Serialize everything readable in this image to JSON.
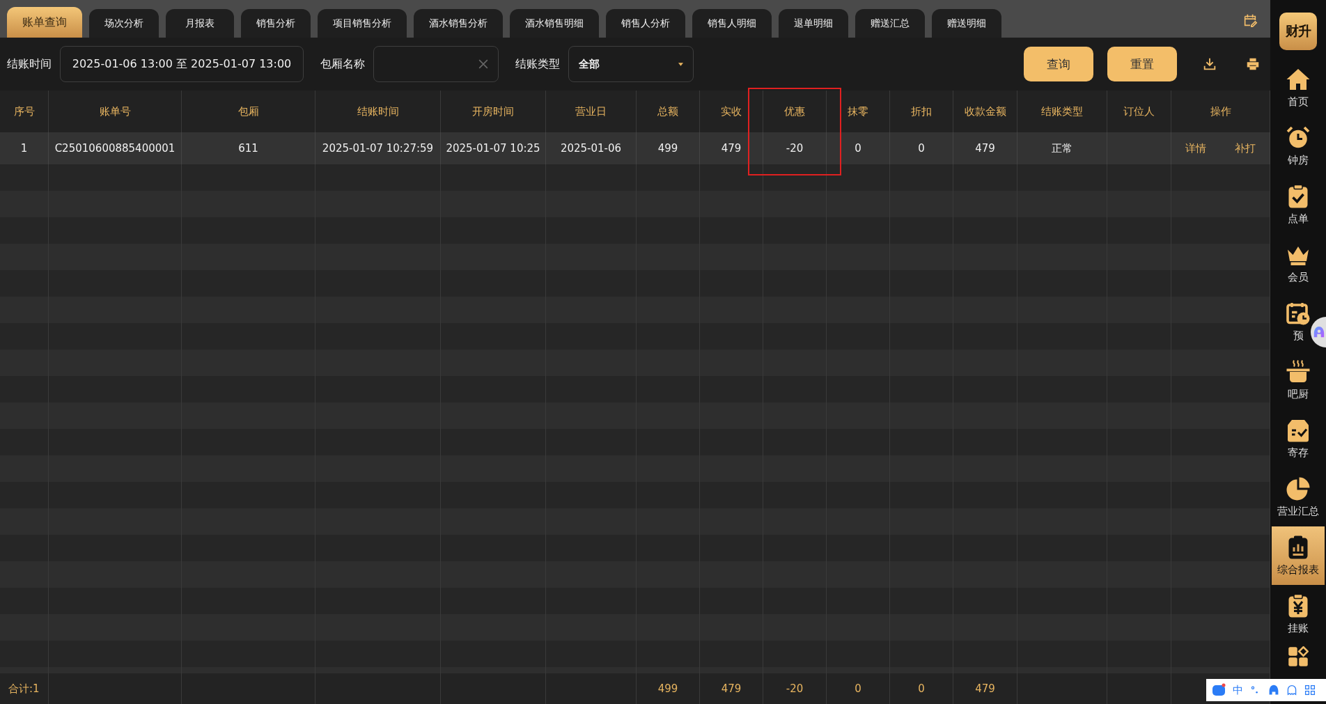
{
  "tabs": [
    {
      "label": "账单查询",
      "selected": true
    },
    {
      "label": "场次分析",
      "selected": false
    },
    {
      "label": "月报表",
      "selected": false
    },
    {
      "label": "销售分析",
      "selected": false
    },
    {
      "label": "项目销售分析",
      "selected": false
    },
    {
      "label": "酒水销售分析",
      "selected": false
    },
    {
      "label": "酒水销售明细",
      "selected": false
    },
    {
      "label": "销售人分析",
      "selected": false
    },
    {
      "label": "销售人明细",
      "selected": false
    },
    {
      "label": "退单明细",
      "selected": false
    },
    {
      "label": "赠送汇总",
      "selected": false
    },
    {
      "label": "赠送明细",
      "selected": false
    }
  ],
  "filters": {
    "settle_time": {
      "label": "结账时间",
      "value": "2025-01-06 13:00 至 2025-01-07 13:00"
    },
    "room_name": {
      "label": "包厢名称"
    },
    "settle_type": {
      "label": "结账类型",
      "value": "全部"
    }
  },
  "buttons": [
    "查询",
    "重置"
  ],
  "table": {
    "columns": [
      {
        "title": "序号",
        "highlighted": false
      },
      {
        "title": "账单号",
        "highlighted": false
      },
      {
        "title": "包厢",
        "highlighted": false
      },
      {
        "title": "结账时间",
        "highlighted": false
      },
      {
        "title": "开房时间",
        "highlighted": false
      },
      {
        "title": "营业日",
        "highlighted": false
      },
      {
        "title": "总额",
        "highlighted": false,
        "total": "499"
      },
      {
        "title": "实收",
        "highlighted": false,
        "total": "479"
      },
      {
        "title": "优惠",
        "highlighted": true,
        "total": "-20"
      },
      {
        "title": "抹零",
        "highlighted": false,
        "total": "0"
      },
      {
        "title": "折扣",
        "highlighted": false,
        "total": "0"
      },
      {
        "title": "收款金额",
        "highlighted": false,
        "total": "479"
      },
      {
        "title": "结账类型",
        "highlighted": false
      },
      {
        "title": "订位人",
        "highlighted": false
      },
      {
        "title": "操作",
        "highlighted": false
      }
    ],
    "rows": [
      {
        "cells": [
          "1",
          "C25010600885400001",
          "611",
          "2025-01-07 10:27:59",
          "2025-01-07 10:25",
          "2025-01-06",
          "499",
          "479",
          "-20",
          "0",
          "0",
          "479",
          "正常",
          ""
        ],
        "actions": [
          "详情",
          "补打"
        ]
      }
    ],
    "footer_label": "合计:1"
  },
  "sidebar": {
    "logo": "财升",
    "items": [
      {
        "label": "首页",
        "selected": false
      },
      {
        "label": "钟房",
        "selected": false
      },
      {
        "label": "点单",
        "selected": false
      },
      {
        "label": "会员",
        "selected": false
      },
      {
        "label": "预",
        "selected": false
      },
      {
        "label": "吧厨",
        "selected": false
      },
      {
        "label": "寄存",
        "selected": false
      },
      {
        "label": "营业汇总",
        "selected": false
      },
      {
        "label": "综合报表",
        "selected": true
      },
      {
        "label": "挂账",
        "selected": false
      },
      {
        "selected": false
      }
    ]
  },
  "ime_toolbar": {
    "label": "中"
  }
}
